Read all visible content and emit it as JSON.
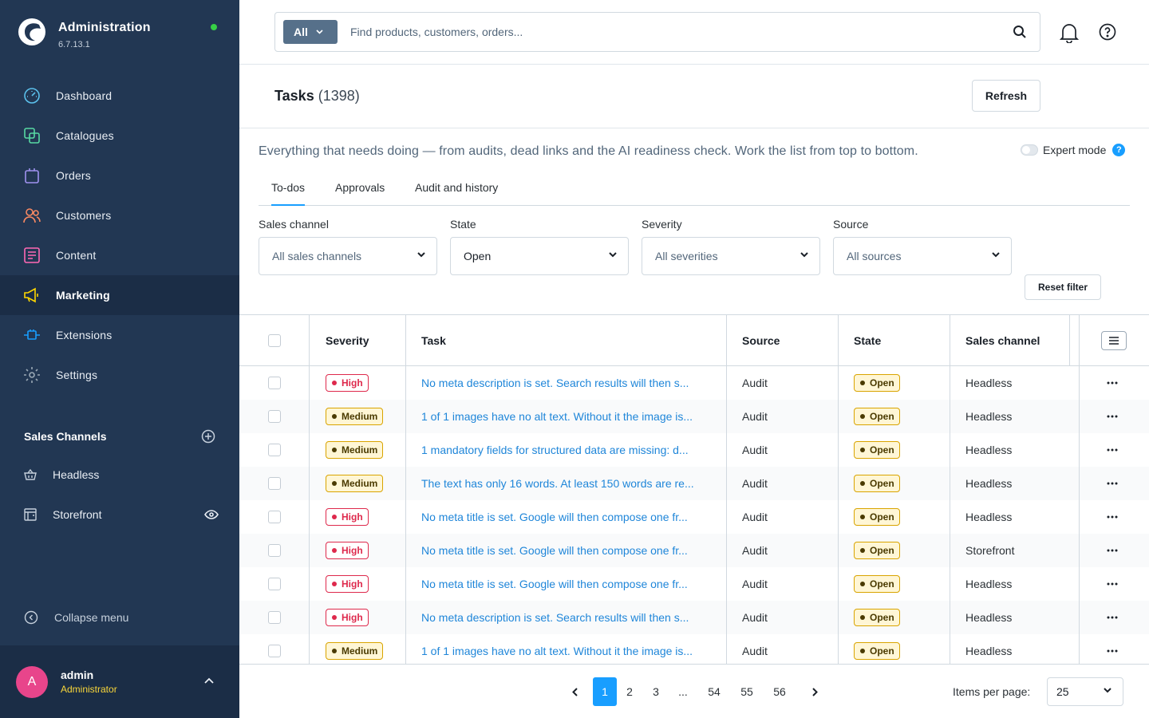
{
  "brand": {
    "title": "Administration",
    "version": "6.7.13.1"
  },
  "nav": [
    {
      "label": "Dashboard",
      "icon": "gauge-icon",
      "color": "#5bc0eb"
    },
    {
      "label": "Catalogues",
      "icon": "catalogue-icon",
      "color": "#57d9a3"
    },
    {
      "label": "Orders",
      "icon": "shopping-bag-icon",
      "color": "#a092f0"
    },
    {
      "label": "Customers",
      "icon": "users-icon",
      "color": "#f88962"
    },
    {
      "label": "Content",
      "icon": "content-icon",
      "color": "#ff68b4"
    },
    {
      "label": "Marketing",
      "icon": "megaphone-icon",
      "color": "#ffd700"
    },
    {
      "label": "Extensions",
      "icon": "plug-icon",
      "color": "#189eff"
    },
    {
      "label": "Settings",
      "icon": "gear-icon",
      "color": "#9aa8b5"
    }
  ],
  "sales_channels": {
    "title": "Sales Channels",
    "items": [
      {
        "label": "Headless"
      },
      {
        "label": "Storefront"
      }
    ]
  },
  "collapse_label": "Collapse menu",
  "user": {
    "initial": "A",
    "name": "admin",
    "role": "Administrator"
  },
  "search": {
    "type": "All",
    "placeholder": "Find products, customers, orders..."
  },
  "page": {
    "title": "Tasks",
    "count": "(1398)",
    "refresh_label": "Refresh",
    "description": "Everything that needs doing — from audits, dead links and the AI readiness check. Work the list from top to bottom.",
    "expert_mode_label": "Expert mode"
  },
  "tabs": [
    "To-dos",
    "Approvals",
    "Audit and history"
  ],
  "filters": [
    {
      "label": "Sales channel",
      "value": "All sales channels"
    },
    {
      "label": "State",
      "value": "Open"
    },
    {
      "label": "Severity",
      "value": "All severities"
    },
    {
      "label": "Source",
      "value": "All sources"
    }
  ],
  "reset_filter_label": "Reset filter",
  "table": {
    "columns": [
      "Severity",
      "Task",
      "Source",
      "State",
      "Sales channel"
    ],
    "rows": [
      {
        "severity": "High",
        "task": "No meta description is set. Search results will then s...",
        "source": "Audit",
        "state": "Open",
        "channel": "Headless"
      },
      {
        "severity": "Medium",
        "task": "1 of 1 images have no alt text. Without it the image is...",
        "source": "Audit",
        "state": "Open",
        "channel": "Headless"
      },
      {
        "severity": "Medium",
        "task": "1 mandatory fields for structured data are missing: d...",
        "source": "Audit",
        "state": "Open",
        "channel": "Headless"
      },
      {
        "severity": "Medium",
        "task": "The text has only 16 words. At least 150 words are re...",
        "source": "Audit",
        "state": "Open",
        "channel": "Headless"
      },
      {
        "severity": "High",
        "task": "No meta title is set. Google will then compose one fr...",
        "source": "Audit",
        "state": "Open",
        "channel": "Headless"
      },
      {
        "severity": "High",
        "task": "No meta title is set. Google will then compose one fr...",
        "source": "Audit",
        "state": "Open",
        "channel": "Storefront"
      },
      {
        "severity": "High",
        "task": "No meta title is set. Google will then compose one fr...",
        "source": "Audit",
        "state": "Open",
        "channel": "Headless"
      },
      {
        "severity": "High",
        "task": "No meta description is set. Search results will then s...",
        "source": "Audit",
        "state": "Open",
        "channel": "Headless"
      },
      {
        "severity": "Medium",
        "task": "1 of 1 images have no alt text. Without it the image is...",
        "source": "Audit",
        "state": "Open",
        "channel": "Headless"
      }
    ]
  },
  "pagination": {
    "pages": [
      "1",
      "2",
      "3",
      "...",
      "54",
      "55",
      "56"
    ],
    "current": "1",
    "items_per_page_label": "Items per page:",
    "items_per_page": "25"
  },
  "colors": {
    "sidebar": "#223753",
    "accent": "#189eff",
    "high": "#de294c",
    "medium": "#d9a400"
  }
}
